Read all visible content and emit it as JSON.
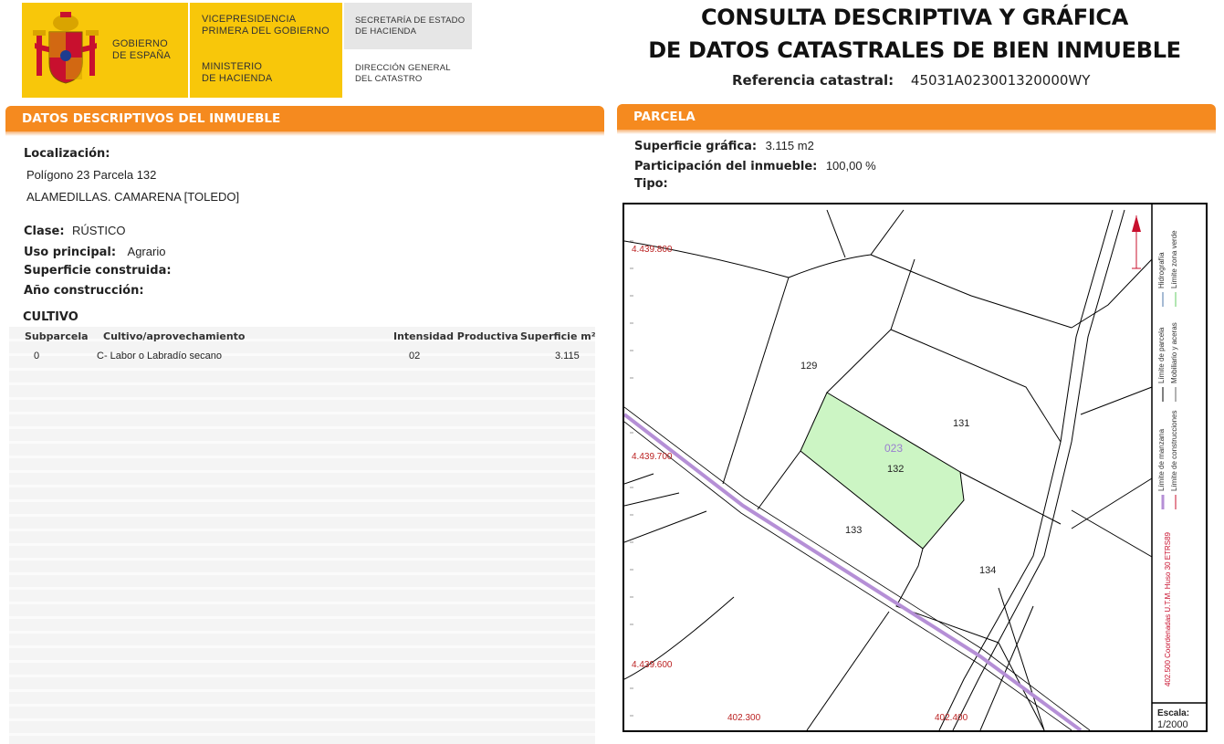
{
  "header": {
    "gov_line1": "GOBIERNO",
    "gov_line2": "DE ESPAÑA",
    "vice_line1": "VICEPRESIDENCIA",
    "vice_line2": "PRIMERA DEL GOBIERNO",
    "min_line1": "MINISTERIO",
    "min_line2": "DE HACIENDA",
    "sec_line1": "SECRETARÍA DE ESTADO",
    "sec_line2": "DE HACIENDA",
    "dg_line1": "DIRECCIÓN GENERAL",
    "dg_line2": "DEL CATASTRO",
    "title_line1": "CONSULTA DESCRIPTIVA Y GRÁFICA",
    "title_line2": "DE DATOS CATASTRALES DE BIEN INMUEBLE",
    "ref_label": "Referencia catastral:",
    "ref_value": "45031A023001320000WY"
  },
  "descriptivos": {
    "section_title": "DATOS DESCRIPTIVOS DEL INMUEBLE",
    "localizacion_label": "Localización:",
    "loc_line1": "Polígono 23 Parcela 132",
    "loc_line2": "ALAMEDILLAS. CAMARENA [TOLEDO]",
    "clase_label": "Clase:",
    "clase_value": "RÚSTICO",
    "uso_label": "Uso principal:",
    "uso_value": "Agrario",
    "sup_construida_label": "Superficie construida:",
    "ano_label": "Año construcción:"
  },
  "cultivo": {
    "title": "CULTIVO",
    "headers": [
      "Subparcela",
      "Cultivo/aprovechamiento",
      "Intensidad Productiva",
      "Superficie m²"
    ],
    "rows": [
      [
        "0",
        "C- Labor o Labradío secano",
        "02",
        "3.115"
      ]
    ]
  },
  "parcela": {
    "section_title": "PARCELA",
    "sup_grafica_label": "Superficie gráfica:",
    "sup_grafica_value": "3.115 m2",
    "participacion_label": "Participación del inmueble:",
    "participacion_value": "100,00 %",
    "tipo_label": "Tipo:"
  },
  "map": {
    "coord_y1": "4.439.800",
    "coord_y2": "4.439.700",
    "coord_y3": "4.439.600",
    "coord_x1": "402.300",
    "coord_x2": "402.400",
    "poligono": "023",
    "parcel_129": "129",
    "parcel_131": "131",
    "parcel_132": "132",
    "parcel_133": "133",
    "parcel_134": "134",
    "highlight_color": "#ccf5c4",
    "road_color": "#b58fd6",
    "legend_hidrografia": "Hidrografía",
    "legend_zona_verde": "Límite zona verde",
    "legend_parcela": "Límite de parcela",
    "legend_mobiliario": "Mobiliario y aceras",
    "legend_manzana": "Límite de manzana",
    "legend_construcciones": "Límite de construcciones",
    "legend_coords": "402.500 Coordenadas U.T.M. Huso 30 ETRS89",
    "escala_label": "Escala:",
    "escala_value": "1/2000"
  }
}
